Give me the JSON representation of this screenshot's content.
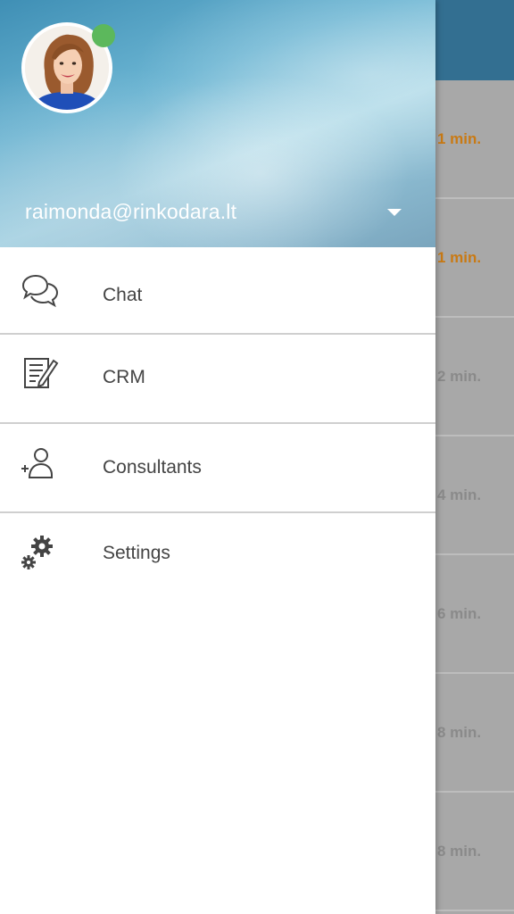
{
  "account": {
    "email": "raimonda@rinkodara.lt",
    "status": "online",
    "status_color": "#5cb85c"
  },
  "menu": {
    "items": [
      {
        "label": "Chat",
        "icon": "chat-bubbles-icon"
      },
      {
        "label": "CRM",
        "icon": "edit-document-icon"
      },
      {
        "label": "Consultants",
        "icon": "add-user-icon"
      },
      {
        "label": "Settings",
        "icon": "gears-icon"
      }
    ]
  },
  "background_list": {
    "times": [
      "1 min.",
      "1 min.",
      "2 min.",
      "4 min.",
      "6 min.",
      "8 min.",
      "8 min."
    ]
  },
  "colors": {
    "appbar": "#336f91",
    "accent_time": "#c97a14"
  }
}
